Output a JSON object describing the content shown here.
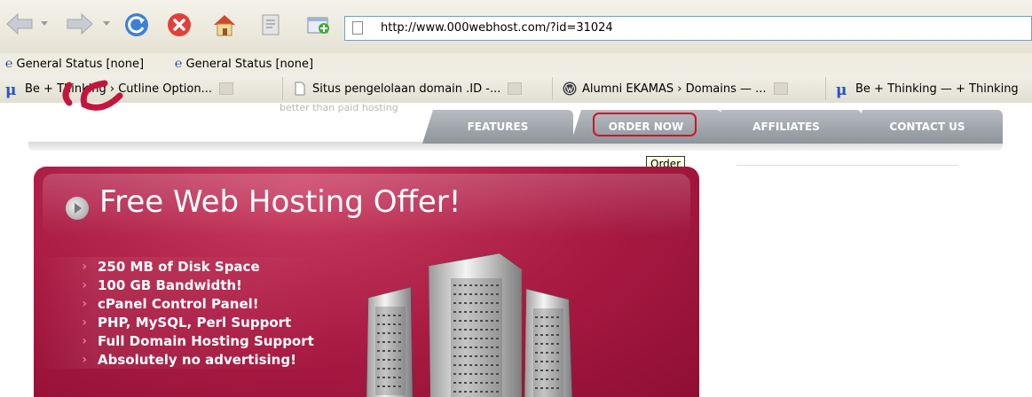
{
  "toolbar": {
    "icons": [
      "back-arrow-icon",
      "forward-arrow-icon",
      "refresh-icon",
      "stop-icon",
      "home-icon",
      "history-icon",
      "new-tab-icon",
      "page-icon"
    ],
    "url": "http://www.000webhost.com/?id=31024"
  },
  "links_bar": {
    "items": [
      {
        "label": "General Status [none]"
      },
      {
        "label": "General Status [none]"
      }
    ]
  },
  "tabs": [
    {
      "label": "Be + Thinking › Cutline Option...",
      "icon": "mu-icon"
    },
    {
      "label": "Situs pengelolaan domain .ID -...",
      "icon": "page-icon"
    },
    {
      "label": "Alumni EKAMAS › Domains — ...",
      "icon": "wordpress-icon"
    },
    {
      "label": "Be + Thinking — + Thinking",
      "icon": "mu-icon"
    }
  ],
  "site": {
    "tagline": "better than paid hosting",
    "nav": [
      {
        "label": "FEATURES"
      },
      {
        "label": "ORDER NOW",
        "highlighted": true
      },
      {
        "label": "AFFILIATES"
      },
      {
        "label": "CONTACT US"
      }
    ],
    "tooltip": "Order",
    "hero": {
      "title": "Free Web Hosting Offer!",
      "features": [
        "250 MB of Disk Space",
        "100 GB Bandwidth!",
        "cPanel Control Panel!",
        "PHP, MySQL, Perl Support",
        "Full Domain Hosting Support",
        "Absolutely no advertising!"
      ]
    }
  },
  "colors": {
    "hero_bg": "#a81a42",
    "nav_tab": "#9aa0a6",
    "highlight_outline": "#d8101c",
    "logo_red": "#c4163c"
  }
}
